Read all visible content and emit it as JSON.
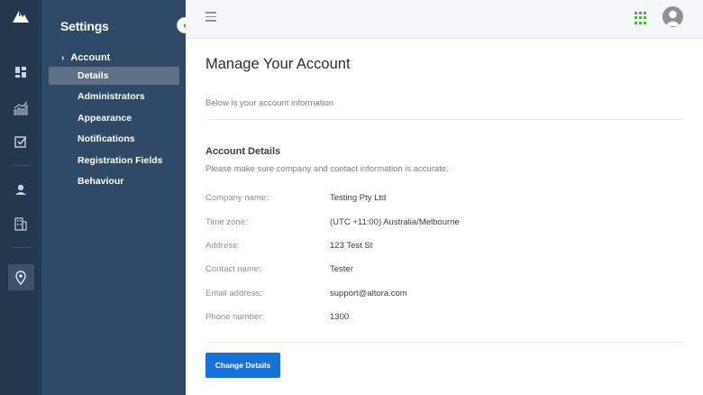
{
  "nav": {
    "title": "Settings",
    "section_label": "Account",
    "items": [
      {
        "label": "Details"
      },
      {
        "label": "Administrators"
      },
      {
        "label": "Appearance"
      },
      {
        "label": "Notifications"
      },
      {
        "label": "Registration Fields"
      },
      {
        "label": "Behaviour"
      }
    ],
    "selected_item": "Details"
  },
  "rail": {
    "icons": [
      "logo-icon",
      "dashboard-icon",
      "analytics-icon",
      "tasks-icon",
      "user-icon",
      "building-icon",
      "location-pin-icon"
    ]
  },
  "header": {
    "icons": [
      "menu-icon",
      "apps-grid-icon",
      "user-avatar-icon"
    ]
  },
  "main": {
    "title": "Manage Your Account",
    "intro": "Below is your account information",
    "section_title": "Account Details",
    "section_desc": "Please make sure company and contact information is accurate.",
    "fields": [
      {
        "label": "Company name:",
        "value": "Testing Pty Ltd"
      },
      {
        "label": "Time zone:",
        "value": "(UTC +11:00) Australia/Melbourne"
      },
      {
        "label": "Address:",
        "value": "123 Test St"
      },
      {
        "label": "Contact name:",
        "value": "Tester"
      },
      {
        "label": "Email address:",
        "value": "support@altora.com"
      },
      {
        "label": "Phone number:",
        "value": "1300"
      }
    ],
    "button_label": "Change Details"
  },
  "colors": {
    "rail_bg": "#23384d",
    "nav_bg": "#2f4a66",
    "selected_bg": "#5d7086",
    "button": "#1672d4",
    "apps_icon": "#4db33d"
  }
}
